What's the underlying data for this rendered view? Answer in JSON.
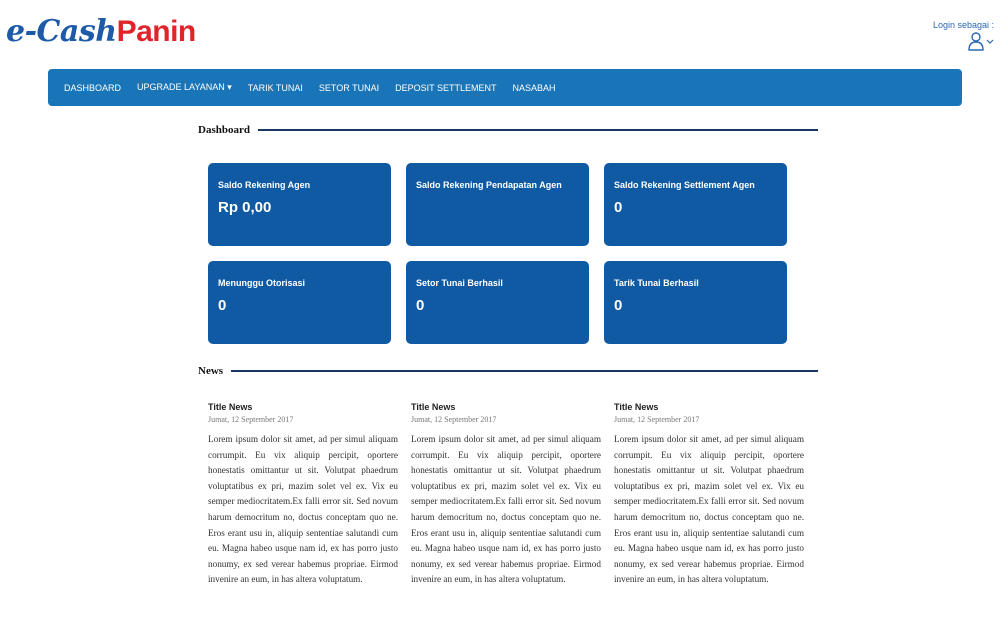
{
  "header": {
    "logo_part1": "e-Cash",
    "logo_part2": "Panin",
    "login_label": "Login sebagai :",
    "brand_blue": "#1d5aa8",
    "brand_red": "#e0252a"
  },
  "nav": {
    "color": "#1a75b8",
    "items": [
      "DASHBOARD",
      "UPGRADE LAYANAN ▾",
      "TARIK TUNAI",
      "SETOR TUNAI",
      "DEPOSIT SETTLEMENT",
      "NASABAH"
    ]
  },
  "dashboard": {
    "heading": "Dashboard",
    "card_color": "#0f5aa3",
    "cards": [
      {
        "label": "Saldo Rekening Agen",
        "value": "Rp 0,00"
      },
      {
        "label": "Saldo Rekening Pendapatan Agen",
        "value": ""
      },
      {
        "label": "Saldo Rekening Settlement Agen",
        "value": "0"
      },
      {
        "label": "Menunggu Otorisasi",
        "value": "0"
      },
      {
        "label": "Setor Tunai Berhasil",
        "value": "0"
      },
      {
        "label": "Tarik Tunai Berhasil",
        "value": "0"
      }
    ]
  },
  "news": {
    "heading": "News",
    "items": [
      {
        "title": "Title News",
        "date": "Jumat, 12 September 2017",
        "body": "Lorem ipsum dolor sit amet, ad per simul aliquam corrumpit. Eu vix aliquip percipit, oportere honestatis omittantur ut sit. Volutpat phaedrum voluptatibus ex pri, mazim solet vel ex. Vix eu semper mediocritatem.Ex falli error sit. Sed novum harum democritum no, doctus conceptam quo ne. Eros erant usu in, aliquip sententiae salutandi cum eu. Magna habeo usque nam id, ex has porro justo nonumy, ex sed verear habemus propriae. Eirmod invenire an eum, in has altera voluptatum."
      },
      {
        "title": "Title News",
        "date": "Jumat, 12 September 2017",
        "body": "Lorem ipsum dolor sit amet, ad per simul aliquam corrumpit. Eu vix aliquip percipit, oportere honestatis omittantur ut sit. Volutpat phaedrum voluptatibus ex pri, mazim solet vel ex. Vix eu semper mediocritatem.Ex falli error sit. Sed novum harum democritum no, doctus conceptam quo ne. Eros erant usu in, aliquip sententiae salutandi cum eu. Magna habeo usque nam id, ex has porro justo nonumy, ex sed verear habemus propriae. Eirmod invenire an eum, in has altera voluptatum."
      },
      {
        "title": "Title News",
        "date": "Jumat, 12 September 2017",
        "body": "Lorem ipsum dolor sit amet, ad per simul aliquam corrumpit. Eu vix aliquip percipit, oportere honestatis omittantur ut sit. Volutpat phaedrum voluptatibus ex pri, mazim solet vel ex. Vix eu semper mediocritatem.Ex falli error sit. Sed novum harum democritum no, doctus conceptam quo ne. Eros erant usu in, aliquip sententiae salutandi cum eu. Magna habeo usque nam id, ex has porro justo nonumy, ex sed verear habemus propriae. Eirmod invenire an eum, in has altera voluptatum."
      }
    ]
  }
}
